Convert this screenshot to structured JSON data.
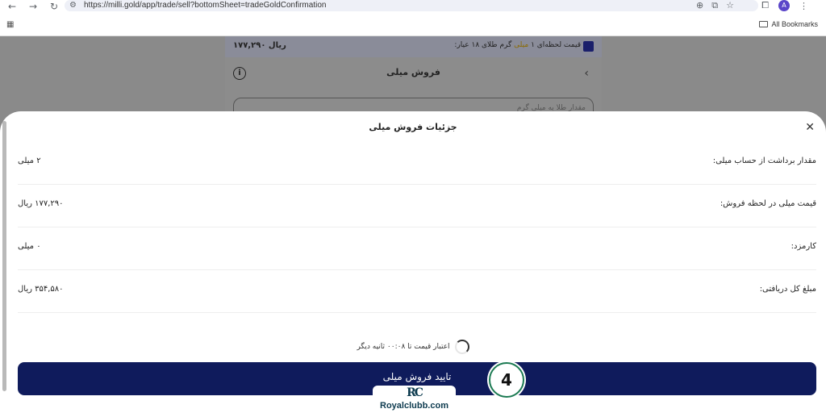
{
  "browser": {
    "url": "https://milli.gold/app/trade/sell?bottomSheet=tradeGoldConfirmation",
    "bookmarks_label": "All Bookmarks",
    "avatar_letter": "A"
  },
  "background_page": {
    "price_label_prefix": "قیمت لحظه‌ای ۱",
    "price_label_brand": "میلی",
    "price_label_suffix": "گرم طلای ۱۸ عیار:",
    "price_value": "۱۷۷,۲۹۰ ریال",
    "title": "فروش میلی",
    "input_placeholder": "مقدار طلا به میلی گرم"
  },
  "sheet": {
    "title": "جزئیات فروش میلی",
    "rows": [
      {
        "label": "مقدار برداشت از حساب میلی:",
        "value": "۲ میلی"
      },
      {
        "label": "قیمت میلی در لحظه فروش:",
        "value": "۱۷۷,۲۹۰ ریال"
      },
      {
        "label": "کارمزد:",
        "value": "۰ میلی"
      },
      {
        "label": "مبلغ کل دریافتی:",
        "value": "۳۵۴,۵۸۰ ریال"
      }
    ],
    "timer_text": "اعتبار قیمت تا ۰۰:۰۸ ثانیه دیگر",
    "confirm_label": "تایید فروش میلی"
  },
  "overlay": {
    "step_number": "4",
    "watermark_logo": "RC",
    "watermark_text": "Royalclubb.com"
  }
}
